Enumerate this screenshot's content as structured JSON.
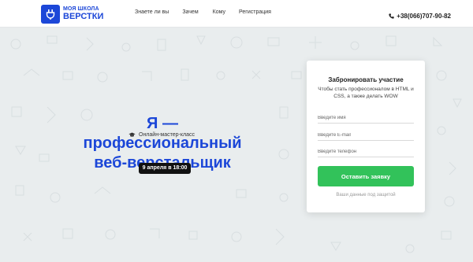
{
  "header": {
    "logo": {
      "line1": "МОЯ ШКОЛА",
      "line2": "ВЕРСТКИ"
    },
    "nav": [
      "Знаете ли вы",
      "Зачем",
      "Кому",
      "Регистрация"
    ],
    "phone": "+38(066)707-90-82"
  },
  "hero": {
    "tagline": "Онлайн-мастер-класс",
    "title_line1": "Я — профессиональный",
    "title_line2": "веб-верстальщик",
    "date": "9 апреля в 18:00"
  },
  "form": {
    "title": "Забронировать участие",
    "description": "Чтобы стать профессионалом в HTML и CSS, а также делать WOW",
    "fields": [
      {
        "placeholder": "Введите имя"
      },
      {
        "placeholder": "Введите E-mail"
      },
      {
        "placeholder": "Введите телефон"
      }
    ],
    "submit_label": "Оставить заявку",
    "privacy": "Ваши данные под защитой"
  },
  "colors": {
    "brand": "#1c47d8",
    "submit": "#32c25a",
    "background": "#e9edee"
  },
  "icons": {
    "logo": "plug-icon",
    "phone": "phone-icon",
    "tagline": "graduation-cap-icon"
  }
}
